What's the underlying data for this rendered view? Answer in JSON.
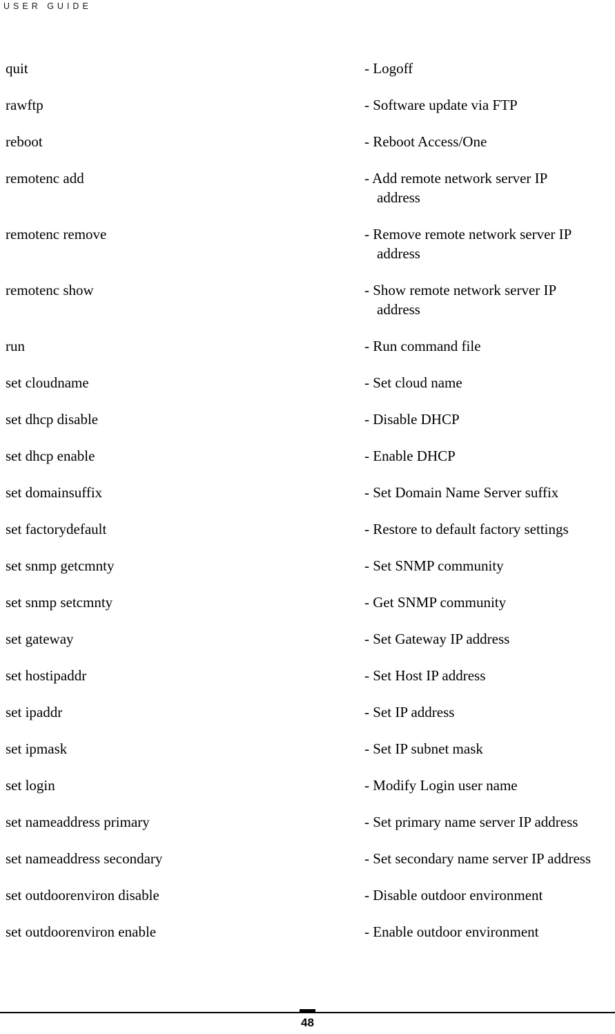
{
  "header": {
    "running_title": "USER GUIDE"
  },
  "commands": [
    {
      "name": "quit",
      "description": "- Logoff",
      "multiline": false
    },
    {
      "name": "rawftp",
      "description": "- Software update via FTP",
      "multiline": false
    },
    {
      "name": "reboot",
      "description": "- Reboot Access/One",
      "multiline": false
    },
    {
      "name": "remotenc add",
      "description": "- Add remote network server IP",
      "continuation": "address",
      "multiline": true
    },
    {
      "name": "remotenc remove",
      "description": "- Remove remote network server IP",
      "continuation": "address",
      "multiline": true
    },
    {
      "name": "remotenc show",
      "description": "- Show remote network server IP",
      "continuation": "address",
      "multiline": true
    },
    {
      "name": "run",
      "description": "- Run command file",
      "multiline": false
    },
    {
      "name": "set cloudname",
      "description": "- Set cloud name",
      "multiline": false
    },
    {
      "name": "set dhcp disable",
      "description": "- Disable DHCP",
      "multiline": false
    },
    {
      "name": "set dhcp enable",
      "description": "- Enable DHCP",
      "multiline": false
    },
    {
      "name": "set domainsuffix",
      "description": "- Set Domain Name Server suffix",
      "multiline": false
    },
    {
      "name": "set factorydefault",
      "description": "- Restore to default factory settings",
      "multiline": false
    },
    {
      "name": "set snmp getcmnty",
      "description": "- Set SNMP community",
      "multiline": false
    },
    {
      "name": "set snmp setcmnty",
      "description": "- Get SNMP community",
      "multiline": false
    },
    {
      "name": "set gateway",
      "description": "- Set Gateway IP address",
      "multiline": false
    },
    {
      "name": "set hostipaddr",
      "description": "- Set Host IP address",
      "multiline": false
    },
    {
      "name": "set ipaddr",
      "description": "- Set IP address",
      "multiline": false
    },
    {
      "name": "set ipmask",
      "description": "- Set IP subnet mask",
      "multiline": false
    },
    {
      "name": "set login",
      "description": "- Modify Login user name",
      "multiline": false
    },
    {
      "name": "set nameaddress primary",
      "description": "- Set primary name server IP address",
      "multiline": false
    },
    {
      "name": "set nameaddress secondary",
      "description": "- Set secondary name server IP address",
      "multiline": false
    },
    {
      "name": "set outdoorenviron disable",
      "description": "- Disable outdoor environment",
      "multiline": false
    },
    {
      "name": "set outdoorenviron enable",
      "description": "- Enable outdoor environment",
      "multiline": false
    }
  ],
  "footer": {
    "page_number": "48"
  }
}
